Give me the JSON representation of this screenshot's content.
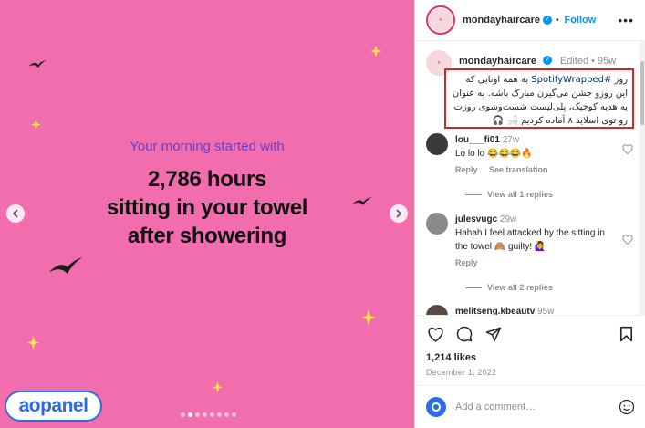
{
  "media": {
    "subtitle": "Your morning started with",
    "headline_1": "2,786 hours",
    "headline_2": "sitting in your towel",
    "headline_3": "after showering",
    "prev_icon": "chevron-left",
    "next_icon": "chevron-right",
    "dots_total": 8,
    "dots_active_index": 1,
    "watermark": "aopanel",
    "background_color": "#f16dae"
  },
  "header": {
    "username": "mondayhaircare",
    "verified_icon": "verified-badge",
    "separator": "•",
    "follow_label": "Follow",
    "more_icon": "more-horizontal"
  },
  "caption": {
    "username": "mondayhaircare",
    "meta": "Edited • 95w",
    "text_prefix": "روز ",
    "hashtag": "#SpotifyWrapped",
    "text_rest": " به همه اونایی که این روزو جشن می‌گیرن مبارک باشه. به عنوان یه هدیه کوچیک، پلی‌لیست شست‌وشوی روزت رو توی اسلاید ۸ آماده کردیم 🛁 🎧"
  },
  "comments": [
    {
      "username": "lou___fi01",
      "time": "27w",
      "text": "Lo lo lo 😂😂😂🔥",
      "reply_label": "Reply",
      "translate_label": "See translation",
      "replies_label": "View all 1 replies"
    },
    {
      "username": "julesvugc",
      "time": "29w",
      "text": "Hahah I feel attacked by the sitting in the towel 🙈 guilty! 🙋‍♀️",
      "reply_label": "Reply",
      "replies_label": "View all 2 replies"
    },
    {
      "username": "melitseng.kbeautv",
      "time": "95w"
    }
  ],
  "actions": {
    "like_icon": "heart-outline",
    "comment_icon": "comment-bubble",
    "share_icon": "paper-plane",
    "save_icon": "bookmark",
    "likes": "1,214 likes",
    "date": "December 1, 2022"
  },
  "add_comment": {
    "placeholder": "Add a comment…",
    "emoji_icon": "smiley-face"
  }
}
